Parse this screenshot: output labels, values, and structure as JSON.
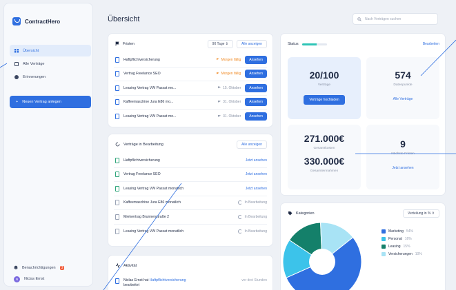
{
  "app": {
    "name": "ContractHero",
    "page_title": "Übersicht"
  },
  "sidebar": {
    "items": [
      {
        "label": "Übersicht"
      },
      {
        "label": "Alle Verträge"
      },
      {
        "label": "Erinnerungen"
      }
    ],
    "new_button": "Neuen Vertrag anlegen",
    "notifications_label": "Benachrichtigungen",
    "notifications_count": "3",
    "user_name": "Niclas Ernst",
    "user_initial": "N"
  },
  "search": {
    "placeholder": "Nach Verträgen suchen"
  },
  "fristen": {
    "title": "Fristen",
    "range": "90 Tage",
    "show_all": "Alle anzeigen",
    "rows": [
      {
        "name": "Haftpflichtversicherung",
        "due": "Morgen fällig",
        "tone": "orange",
        "action": "Ansehen"
      },
      {
        "name": "Vertrag Freelance SEO",
        "due": "Morgen fällig",
        "tone": "orange",
        "action": "Ansehen"
      },
      {
        "name": "Leasing Vertrag VW Passat mo...",
        "due": "15. Oktober",
        "tone": "grey",
        "action": "Ansehen"
      },
      {
        "name": "Kaffeemaschine Jura E86 mo...",
        "due": "31. Oktober",
        "tone": "grey",
        "action": "Ansehen"
      },
      {
        "name": "Leasing Vertrag VW Passat mo...",
        "due": "31. Oktober",
        "tone": "grey",
        "action": "Ansehen"
      }
    ]
  },
  "bearbeitung": {
    "title": "Verträge in Bearbeitung",
    "show_all": "Alle anzeigen",
    "rows": [
      {
        "name": "Haftpflichtversicherung",
        "status": "Jetzt ansehen",
        "kind": "link",
        "doc": "green"
      },
      {
        "name": "Vertrag Freelance SEO",
        "status": "Jetzt ansehen",
        "kind": "link",
        "doc": "green"
      },
      {
        "name": "Leasing Vertrag VW Passat monatlich",
        "status": "Jetzt ansehen",
        "kind": "link",
        "doc": "green"
      },
      {
        "name": "Kaffeemaschine Jura E86 monatlich",
        "status": "In Bearbeitung",
        "kind": "pending",
        "doc": "grey"
      },
      {
        "name": "Mietvertrag Brunnenstraße 2",
        "status": "In Bearbeitung",
        "kind": "pending",
        "doc": "grey"
      },
      {
        "name": "Leasing Vertrag VW Passat monatlich",
        "status": "In Bearbeitung",
        "kind": "pending",
        "doc": "grey"
      }
    ]
  },
  "aktivitat": {
    "title": "Aktivität",
    "user": "Niclas Ernst hat",
    "link": "Haftpflichtversicherung",
    "suffix": "bearbeitet",
    "time": "vor drei Stunden"
  },
  "status": {
    "title": "Status",
    "edit": "Bearbeiten",
    "progress": 0.6,
    "contracts": "20/100",
    "contracts_label": "Verträge",
    "upload_button": "Verträge hochladen",
    "datapoints": "574",
    "datapoints_label": "Datenpunkte",
    "all_contracts_link": "Alle Verträge",
    "costs": "271.000€",
    "costs_label": "Gesamtkosten",
    "income": "330.000€",
    "income_label": "Gesamteinnahmen",
    "deadlines": "9",
    "deadlines_label": "Nächste Fristen",
    "deadlines_link": "Jetzt ansehen"
  },
  "kategorien": {
    "title": "Kategorien",
    "select": "Verteilung in %"
  },
  "chart_data": {
    "type": "pie",
    "title": "Kategorien",
    "categories": [
      "Marketing",
      "Personal",
      "Leasing",
      "Versicherungen"
    ],
    "values": [
      54,
      16,
      15,
      15
    ],
    "value_labels": [
      "54%",
      "16%",
      "15%",
      "10%"
    ],
    "colors": [
      "#2f6fe0",
      "#3cc3ea",
      "#14806a",
      "#a8e3f5"
    ]
  },
  "colors": {
    "accent": "#2f6fe0",
    "warning": "#f08a24",
    "badge": "#f25c3a"
  }
}
